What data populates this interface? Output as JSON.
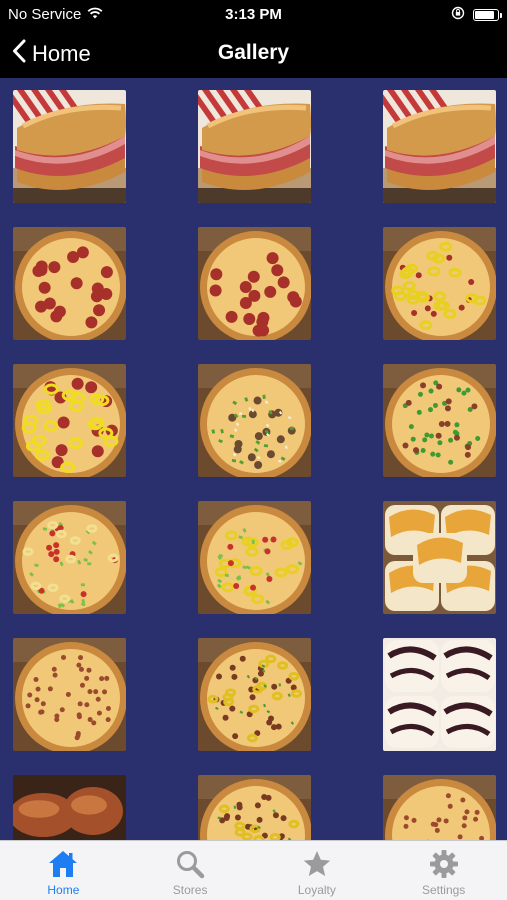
{
  "status_bar": {
    "carrier": "No Service",
    "time": "3:13 PM",
    "battery_level": 0.9
  },
  "nav": {
    "back_label": "Home",
    "title": "Gallery"
  },
  "colors": {
    "gallery_background": "#2a2f6e",
    "tab_active": "#1e7df0",
    "tab_inactive": "#9b9b9b"
  },
  "gallery": {
    "images": [
      "sub-sandwich",
      "sub-sandwich",
      "sub-sandwich",
      "pepperoni-pizza",
      "pepperoni-pizza",
      "banana-pepper-pizza",
      "pepperoni-banana-pepper-pizza",
      "supreme-pizza",
      "green-onion-pizza",
      "veggie-pizza",
      "banana-pepper-veggie-pizza",
      "cheese-bread",
      "sausage-pizza",
      "loaded-pizza",
      "cinnamon-dessert",
      "wings",
      "loaded-pizza",
      "sausage-pizza"
    ]
  },
  "tab_bar": {
    "tabs": [
      {
        "label": "Home",
        "icon": "home-icon",
        "active": true
      },
      {
        "label": "Stores",
        "icon": "search-icon",
        "active": false
      },
      {
        "label": "Loyalty",
        "icon": "star-icon",
        "active": false
      },
      {
        "label": "Settings",
        "icon": "gear-icon",
        "active": false
      }
    ]
  }
}
